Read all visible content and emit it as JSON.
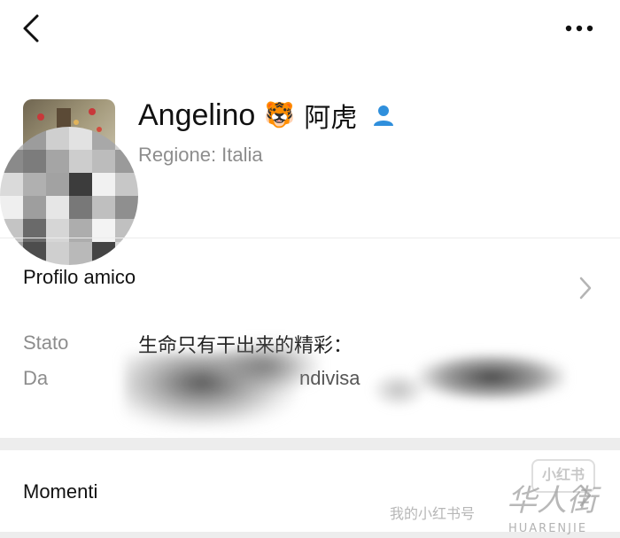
{
  "topbar": {
    "back_icon": "chevron-left-icon",
    "more_icon": "ellipsis-icon"
  },
  "profile": {
    "name": "Angelino",
    "name_emoji": "🐯",
    "name_cn": "阿虎",
    "contact_icon": "person-icon",
    "region": "Regione: Italia",
    "avatar_mosaic": [
      "#bdbdbd",
      "#9c9c9c",
      "#cfcfcf",
      "#e2e2e2",
      "#a8a8a8",
      "#d0d0d0",
      "#8a8a8a",
      "#7c7c7c",
      "#a5a5a5",
      "#cdcdcd",
      "#bcbcbc",
      "#9a9a9a",
      "#dadada",
      "#b0b0b0",
      "#a2a2a2",
      "#3c3c3c",
      "#f1f1f1",
      "#c7c7c7",
      "#efefef",
      "#9e9e9e",
      "#e6e6e6",
      "#787878",
      "#bfbfbf",
      "#8f8f8f",
      "#c4c4c4",
      "#6a6a6a",
      "#d6d6d6",
      "#adadad",
      "#f3f3f3",
      "#c0c0c0",
      "#a0a0a0",
      "#4d4d4d",
      "#cfcfcf",
      "#b9b9b9",
      "#444444",
      "#d9d9d9"
    ]
  },
  "rows": {
    "profile_friend": "Profilo amico",
    "stato_label": "Stato",
    "stato_value": "生命只有干出来的精彩：",
    "da_label": "Da",
    "da_value": "ndivisa",
    "momenti": "Momenti",
    "chevron_icon": "chevron-right-icon"
  },
  "watermark": {
    "badge": "小红书",
    "text": "我的小红书号",
    "brand_cn": "华人街",
    "brand_en": "HUARENJIE"
  },
  "colors": {
    "accent_blue": "#2f8fdc",
    "secondary_text": "#8d8d8d",
    "divider": "#ededed"
  }
}
